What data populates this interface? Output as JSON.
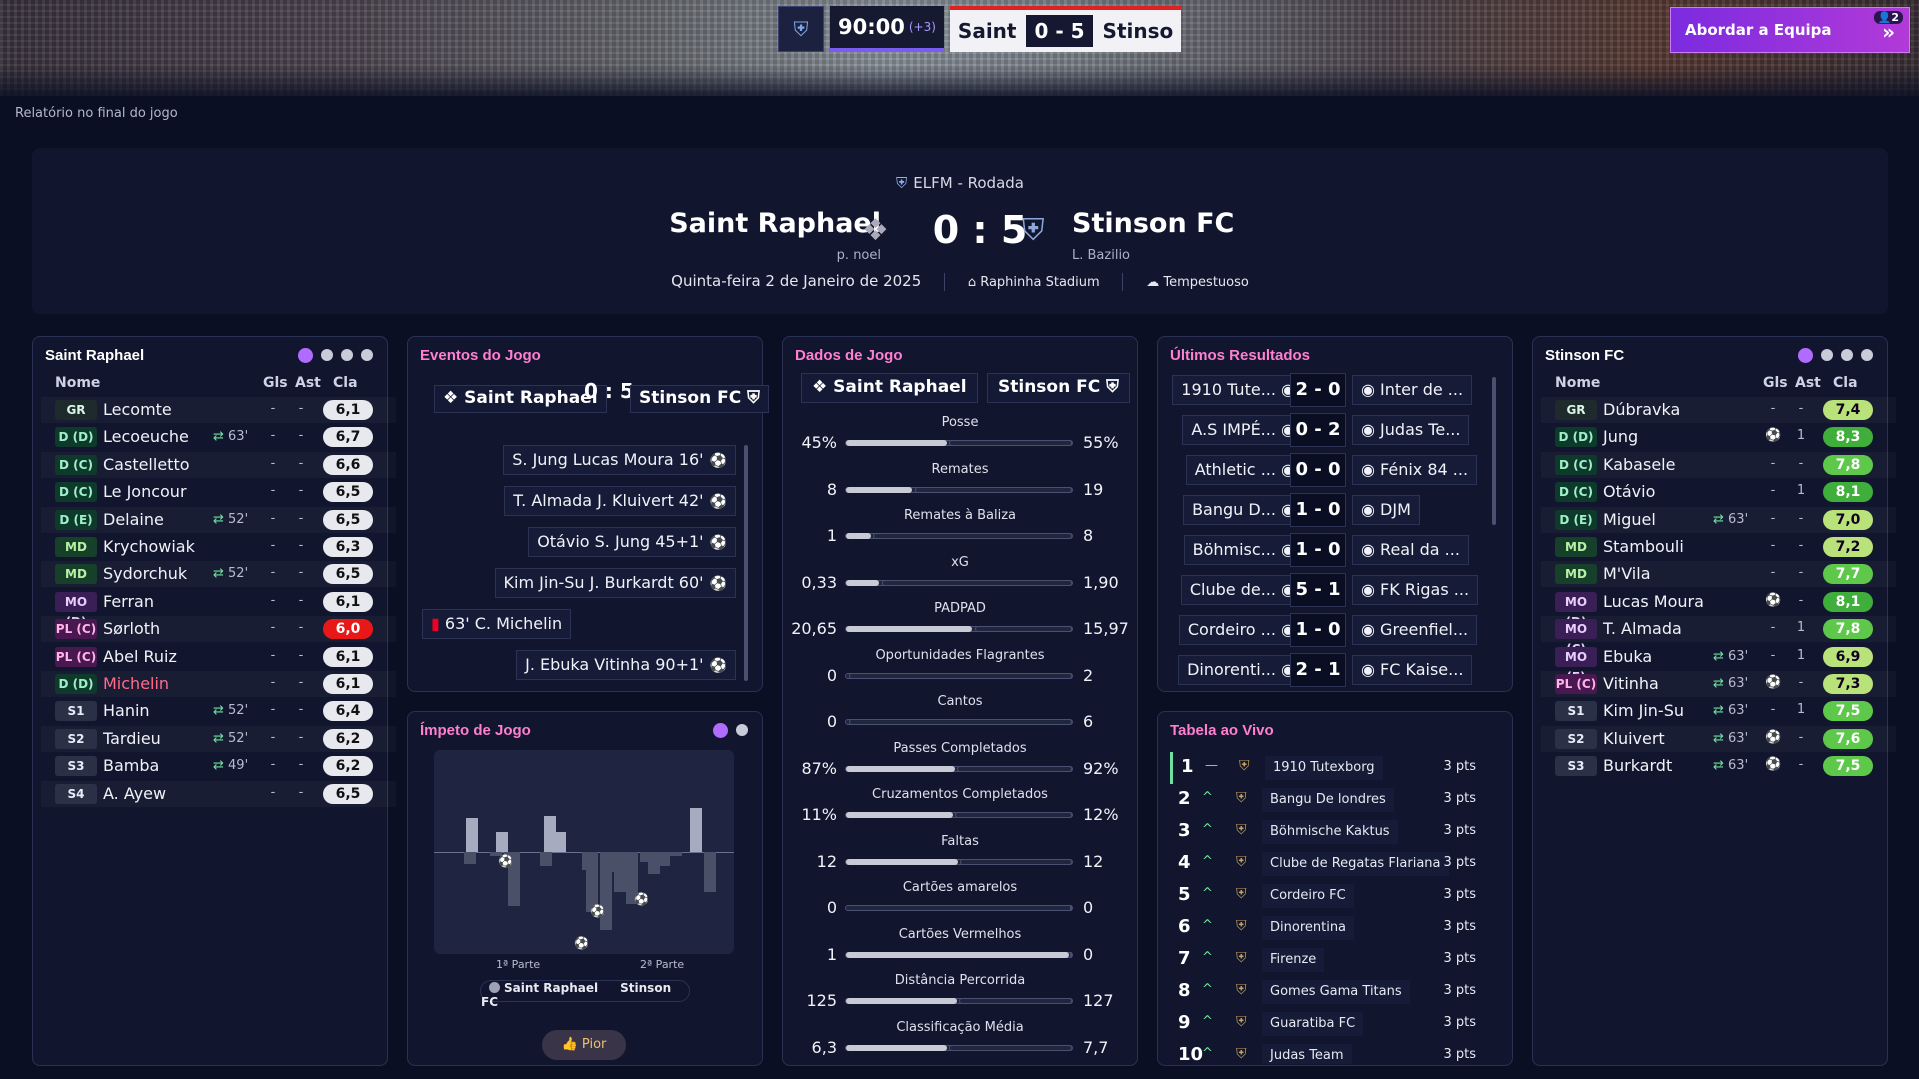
{
  "topbar": {
    "time": "90:00",
    "added": "(+3)",
    "home_short": "Saint",
    "away_short": "Stinso",
    "score": "0 - 5",
    "action_label": "Abordar a Equipa",
    "action_badge": "2"
  },
  "page": {
    "subtitle": "Relatório no final do jogo"
  },
  "match": {
    "competition": "ELFM - Rodada",
    "home": "Saint Raphael",
    "away": "Stinson FC",
    "home_manager": "p. noel",
    "away_manager": "L. Bazilio",
    "score": "0 : 5",
    "date": "Quinta-feira 2 de Janeiro de 2025",
    "stadium": "Raphinha Stadium",
    "weather": "Tempestuoso"
  },
  "columns": {
    "name": "Nome",
    "goals": "Gls",
    "assists": "Ast",
    "rating": "Cla"
  },
  "home_lineup": {
    "title": "Saint Raphael",
    "players": [
      {
        "pos": "GR",
        "cls": "gk",
        "name": "Lecomte",
        "ev": "",
        "g": "-",
        "a": "-",
        "r": "6,1"
      },
      {
        "pos": "D (D)",
        "cls": "df",
        "name": "Lecoeuche",
        "ev": "63'",
        "g": "-",
        "a": "-",
        "r": "6,7"
      },
      {
        "pos": "D (C)",
        "cls": "df",
        "name": "Castelletto",
        "ev": "",
        "g": "-",
        "a": "-",
        "r": "6,6"
      },
      {
        "pos": "D (C)",
        "cls": "df",
        "name": "Le Joncour",
        "ev": "",
        "g": "-",
        "a": "-",
        "r": "6,5"
      },
      {
        "pos": "D (E)",
        "cls": "df",
        "name": "Delaine",
        "ev": "52'",
        "g": "-",
        "a": "-",
        "r": "6,5"
      },
      {
        "pos": "MD",
        "cls": "md",
        "name": "Krychowiak",
        "ev": "",
        "g": "-",
        "a": "-",
        "r": "6,3"
      },
      {
        "pos": "MD",
        "cls": "md",
        "name": "Sydorchuk",
        "ev": "52'",
        "g": "-",
        "a": "-",
        "r": "6,5"
      },
      {
        "pos": "MO (D)",
        "cls": "mo",
        "name": "Ferran",
        "ev": "",
        "g": "-",
        "a": "-",
        "r": "6,1"
      },
      {
        "pos": "PL (C)",
        "cls": "pl",
        "name": "Sørloth",
        "ev": "",
        "g": "-",
        "a": "-",
        "r": "6,0"
      },
      {
        "pos": "PL (C)",
        "cls": "pl",
        "name": "Abel Ruiz",
        "ev": "",
        "g": "-",
        "a": "-",
        "r": "6,1"
      },
      {
        "pos": "D (D)",
        "cls": "df",
        "name": "Michelin",
        "ev": "",
        "g": "-",
        "a": "-",
        "r": "6,1"
      },
      {
        "pos": "S1",
        "cls": "sub",
        "name": "Hanin",
        "ev": "52'",
        "g": "-",
        "a": "-",
        "r": "6,4"
      },
      {
        "pos": "S2",
        "cls": "sub",
        "name": "Tardieu",
        "ev": "52'",
        "g": "-",
        "a": "-",
        "r": "6,2"
      },
      {
        "pos": "S3",
        "cls": "sub",
        "name": "Bamba",
        "ev": "49'",
        "g": "-",
        "a": "-",
        "r": "6,2"
      },
      {
        "pos": "S4",
        "cls": "sub",
        "name": "A. Ayew",
        "ev": "",
        "g": "-",
        "a": "-",
        "r": "6,5"
      }
    ]
  },
  "away_lineup": {
    "title": "Stinson FC",
    "players": [
      {
        "pos": "GR",
        "cls": "gk",
        "name": "Dúbravka",
        "ev": "",
        "g": "-",
        "a": "-",
        "r": "7,4"
      },
      {
        "pos": "D (D)",
        "cls": "df",
        "name": "Jung",
        "ev": "",
        "g": "",
        "a": "1",
        "r": "8,3"
      },
      {
        "pos": "D (C)",
        "cls": "df",
        "name": "Kabasele",
        "ev": "",
        "g": "-",
        "a": "-",
        "r": "7,8"
      },
      {
        "pos": "D (C)",
        "cls": "df",
        "name": "Otávio",
        "ev": "",
        "g": "-",
        "a": "1",
        "r": "8,1"
      },
      {
        "pos": "D (E)",
        "cls": "df",
        "name": "Miguel",
        "ev": "63'",
        "g": "-",
        "a": "-",
        "r": "7,0"
      },
      {
        "pos": "MD",
        "cls": "md",
        "name": "Stambouli",
        "ev": "",
        "g": "-",
        "a": "-",
        "r": "7,2"
      },
      {
        "pos": "MD",
        "cls": "md",
        "name": "M'Vila",
        "ev": "",
        "g": "-",
        "a": "-",
        "r": "7,7"
      },
      {
        "pos": "MO (D)",
        "cls": "mo",
        "name": "Lucas Moura",
        "ev": "",
        "g": "",
        "a": "-",
        "r": "8,1"
      },
      {
        "pos": "MO (C)",
        "cls": "mo",
        "name": "T. Almada",
        "ev": "",
        "g": "-",
        "a": "1",
        "r": "7,8"
      },
      {
        "pos": "MO (E)",
        "cls": "mo",
        "name": "Ebuka",
        "ev": "63'",
        "g": "-",
        "a": "1",
        "r": "6,9"
      },
      {
        "pos": "PL (C)",
        "cls": "pl",
        "name": "Vitinha",
        "ev": "63'",
        "g": "",
        "a": "-",
        "r": "7,3"
      },
      {
        "pos": "S1",
        "cls": "sub",
        "name": "Kim Jin-Su",
        "ev": "63'",
        "g": "-",
        "a": "1",
        "r": "7,5"
      },
      {
        "pos": "S2",
        "cls": "sub",
        "name": "Kluivert",
        "ev": "63'",
        "g": "",
        "a": "-",
        "r": "7,6"
      },
      {
        "pos": "S3",
        "cls": "sub",
        "name": "Burkardt",
        "ev": "63'",
        "g": "",
        "a": "-",
        "r": "7,5"
      }
    ]
  },
  "events": {
    "title": "Eventos do Jogo",
    "home": "Saint Raphael",
    "away": "Stinson FC",
    "score": "0 : 5",
    "items": [
      {
        "text": "S. Jung  Lucas Moura 16'",
        "side": "away"
      },
      {
        "text": "T. Almada  J. Kluivert 42'",
        "side": "away"
      },
      {
        "text": "Otávio  S. Jung 45+1'",
        "side": "away"
      },
      {
        "text": "Kim Jin-Su  J. Burkardt 60'",
        "side": "away"
      },
      {
        "text": "63' C. Michelin",
        "side": "home"
      },
      {
        "text": "J. Ebuka  Vitinha 90+1'",
        "side": "away"
      }
    ]
  },
  "momentum": {
    "title": "Ímpeto de Jogo",
    "first_half": "1ª Parte",
    "second_half": "2ª Parte",
    "legend_home": "Saint Raphael",
    "legend_away": "Stinson FC",
    "worst": "Pior"
  },
  "stats": {
    "title": "Dados de Jogo",
    "home": "Saint Raphael",
    "away": "Stinson FC",
    "items": [
      {
        "label": "Posse",
        "h": "45%",
        "a": "55%",
        "hv": 45,
        "av": 55
      },
      {
        "label": "Remates",
        "h": "8",
        "a": "19",
        "hv": 8,
        "av": 19
      },
      {
        "label": "Remates à Baliza",
        "h": "1",
        "a": "8",
        "hv": 1,
        "av": 8
      },
      {
        "label": "xG",
        "h": "0,33",
        "a": "1,90",
        "hv": 0.33,
        "av": 1.9
      },
      {
        "label": "PADPAD",
        "h": "20,65",
        "a": "15,97",
        "hv": 20.65,
        "av": 15.97
      },
      {
        "label": "Oportunidades Flagrantes",
        "h": "0",
        "a": "2",
        "hv": 0,
        "av": 2
      },
      {
        "label": "Cantos",
        "h": "0",
        "a": "6",
        "hv": 0,
        "av": 6
      },
      {
        "label": "Passes Completados",
        "h": "87%",
        "a": "92%",
        "hv": 87,
        "av": 92
      },
      {
        "label": "Cruzamentos Completados",
        "h": "11%",
        "a": "12%",
        "hv": 11,
        "av": 12
      },
      {
        "label": "Faltas",
        "h": "12",
        "a": "12",
        "hv": 12,
        "av": 12
      },
      {
        "label": "Cartões amarelos",
        "h": "0",
        "a": "0",
        "hv": 0,
        "av": 0
      },
      {
        "label": "Cartões Vermelhos",
        "h": "1",
        "a": "0",
        "hv": 1,
        "av": 0
      },
      {
        "label": "Distância Percorrida",
        "h": "125",
        "a": "127",
        "hv": 125,
        "av": 127
      },
      {
        "label": "Classificação Média",
        "h": "6,3",
        "a": "7,7",
        "hv": 6.3,
        "av": 7.7
      }
    ]
  },
  "results": {
    "title": "Últimos Resultados",
    "items": [
      {
        "h": "1910 Tute...",
        "s": "2 - 0",
        "a": "Inter de ..."
      },
      {
        "h": "A.S IMPÉ...",
        "s": "0 - 2",
        "a": "Judas Te..."
      },
      {
        "h": "Athletic ...",
        "s": "0 - 0",
        "a": "Fénix 84 ..."
      },
      {
        "h": "Bangu D...",
        "s": "1 - 0",
        "a": "DJM"
      },
      {
        "h": "Böhmisc...",
        "s": "1 - 0",
        "a": "Real da ..."
      },
      {
        "h": "Clube de...",
        "s": "5 - 1",
        "a": "FK Rigas ..."
      },
      {
        "h": "Cordeiro ...",
        "s": "1 - 0",
        "a": "Greenfiel..."
      },
      {
        "h": "Dinorenti...",
        "s": "2 - 1",
        "a": "FC Kaise..."
      }
    ]
  },
  "table": {
    "title": "Tabela ao Vivo",
    "rows": [
      {
        "p": "1",
        "m": "—",
        "n": "1910 Tutexborg",
        "pts": "3 pts"
      },
      {
        "p": "2",
        "m": "^",
        "n": "Bangu De londres",
        "pts": "3 pts"
      },
      {
        "p": "3",
        "m": "^",
        "n": "Böhmische Kaktus",
        "pts": "3 pts"
      },
      {
        "p": "4",
        "m": "^",
        "n": "Clube de Regatas Flariana",
        "pts": "3 pts"
      },
      {
        "p": "5",
        "m": "^",
        "n": "Cordeiro FC",
        "pts": "3 pts"
      },
      {
        "p": "6",
        "m": "^",
        "n": "Dinorentina",
        "pts": "3 pts"
      },
      {
        "p": "7",
        "m": "^",
        "n": "Firenze",
        "pts": "3 pts"
      },
      {
        "p": "8",
        "m": "^",
        "n": "Gomes Gama Titans",
        "pts": "3 pts"
      },
      {
        "p": "9",
        "m": "^",
        "n": "Guaratiba FC",
        "pts": "3 pts"
      },
      {
        "p": "10",
        "m": "^",
        "n": "Judas Team",
        "pts": "3 pts"
      }
    ]
  }
}
